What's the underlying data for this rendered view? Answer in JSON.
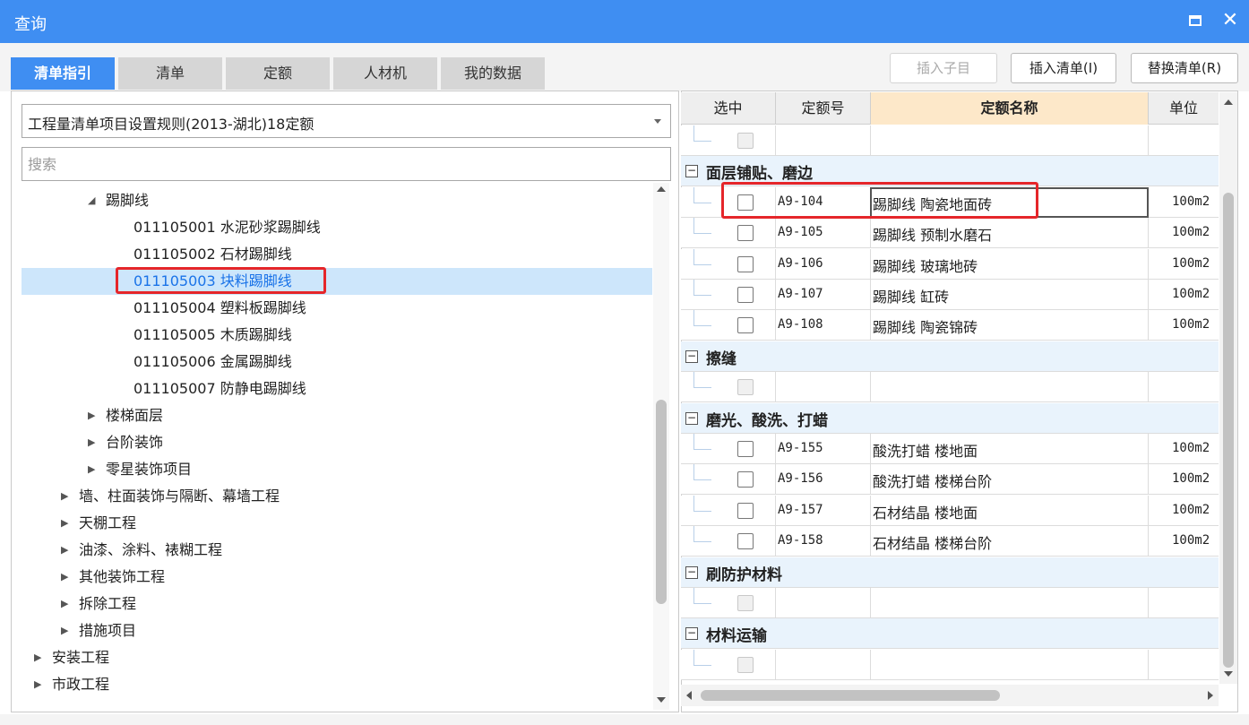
{
  "window": {
    "title": "查询"
  },
  "tabs": [
    {
      "label": "清单指引",
      "active": true
    },
    {
      "label": "清单",
      "active": false
    },
    {
      "label": "定额",
      "active": false
    },
    {
      "label": "人材机",
      "active": false
    },
    {
      "label": "我的数据",
      "active": false
    }
  ],
  "toolbar": {
    "insert_child_label": "插入子目",
    "insert_list_label": "插入清单(I)",
    "replace_list_label": "替换清单(R)"
  },
  "left": {
    "rule_select_value": "工程量清单项目设置规则(2013-湖北)18定额",
    "search_placeholder": "搜索",
    "tree": [
      {
        "caret": "◢",
        "label": "踢脚线"
      },
      {
        "caret": "",
        "label": "011105001  水泥砂浆踢脚线"
      },
      {
        "caret": "",
        "label": "011105002  石材踢脚线"
      },
      {
        "caret": "",
        "label": "011105003  块料踢脚线",
        "selected": true
      },
      {
        "caret": "",
        "label": "011105004  塑料板踢脚线"
      },
      {
        "caret": "",
        "label": "011105005  木质踢脚线"
      },
      {
        "caret": "",
        "label": "011105006  金属踢脚线"
      },
      {
        "caret": "",
        "label": "011105007  防静电踢脚线"
      },
      {
        "caret": "▶",
        "label": "楼梯面层"
      },
      {
        "caret": "▶",
        "label": "台阶装饰"
      },
      {
        "caret": "▶",
        "label": "零星装饰项目"
      },
      {
        "caret": "▶",
        "label": "墙、柱面装饰与隔断、幕墙工程"
      },
      {
        "caret": "▶",
        "label": "天棚工程"
      },
      {
        "caret": "▶",
        "label": "油漆、涂料、裱糊工程"
      },
      {
        "caret": "▶",
        "label": "其他装饰工程"
      },
      {
        "caret": "▶",
        "label": "拆除工程"
      },
      {
        "caret": "▶",
        "label": "措施项目"
      },
      {
        "caret": "▶",
        "label": "安装工程"
      },
      {
        "caret": "▶",
        "label": "市政工程"
      }
    ]
  },
  "grid": {
    "headers": {
      "select": "选中",
      "code": "定额号",
      "name": "定额名称",
      "unit": "单位"
    },
    "groups": [
      {
        "name": "面层铺贴、磨边",
        "expander": "−"
      },
      {
        "name": "擦缝",
        "expander": "−"
      },
      {
        "name": "磨光、酸洗、打蜡",
        "expander": "−"
      },
      {
        "name": "刷防护材料",
        "expander": "−"
      },
      {
        "name": "材料运输",
        "expander": "−"
      }
    ],
    "rows": [
      {
        "code": "A9-104",
        "name": "踢脚线 陶瓷地面砖",
        "unit": "100m2"
      },
      {
        "code": "A9-105",
        "name": "踢脚线 预制水磨石",
        "unit": "100m2"
      },
      {
        "code": "A9-106",
        "name": "踢脚线 玻璃地砖",
        "unit": "100m2"
      },
      {
        "code": "A9-107",
        "name": "踢脚线 缸砖",
        "unit": "100m2"
      },
      {
        "code": "A9-108",
        "name": "踢脚线 陶瓷锦砖",
        "unit": "100m2"
      },
      {
        "code": "A9-155",
        "name": "酸洗打蜡 楼地面",
        "unit": "100m2"
      },
      {
        "code": "A9-156",
        "name": "酸洗打蜡 楼梯台阶",
        "unit": "100m2"
      },
      {
        "code": "A9-157",
        "name": "石材结晶 楼地面",
        "unit": "100m2"
      },
      {
        "code": "A9-158",
        "name": "石材结晶 楼梯台阶",
        "unit": "100m2"
      }
    ]
  },
  "colors": {
    "accent": "#3f8ef2",
    "highlight": "#e5262a",
    "selected_row": "#cde6fb",
    "group_row": "#e9f3fc"
  }
}
